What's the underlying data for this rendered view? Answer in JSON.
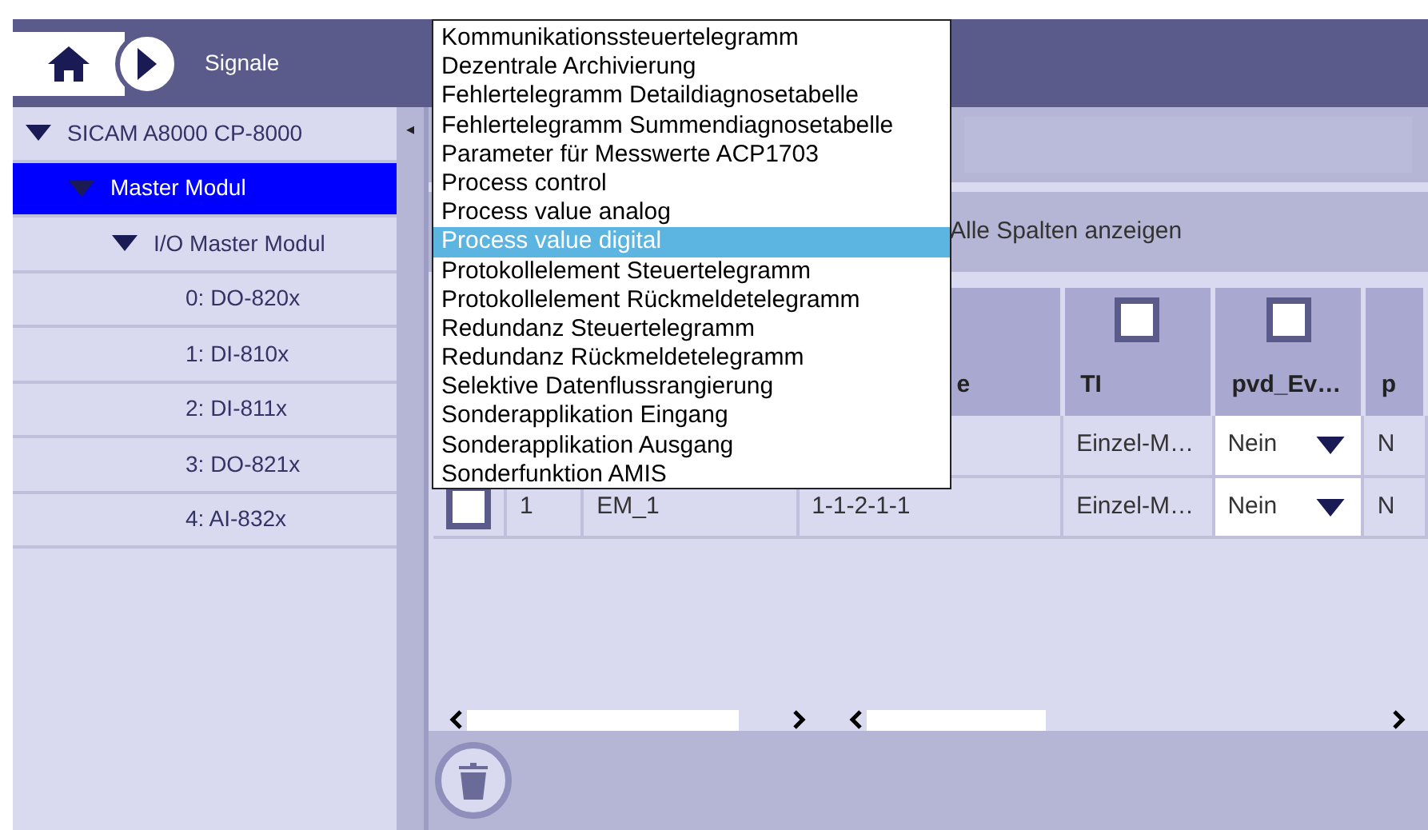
{
  "header": {
    "title": "Signale"
  },
  "sidebar": {
    "collapse": "◂",
    "items": [
      {
        "label": "SICAM A8000 CP-8000",
        "expanded": true,
        "selected": false,
        "children": [
          {
            "label": "Master Modul",
            "expanded": true,
            "selected": true,
            "children": [
              {
                "label": "I/O Master Modul",
                "expanded": true,
                "selected": false,
                "children": [
                  {
                    "label": "0: DO-820x",
                    "selected": false
                  },
                  {
                    "label": "1: DI-810x",
                    "selected": false
                  },
                  {
                    "label": "2: DI-811x",
                    "selected": false
                  },
                  {
                    "label": "3: DO-821x",
                    "selected": false
                  },
                  {
                    "label": "4: AI-832x",
                    "selected": false
                  }
                ]
              }
            ]
          }
        ]
      }
    ]
  },
  "toolbar": {
    "show_all_columns": "Alle Spalten anzeigen"
  },
  "table": {
    "columns": [
      {
        "kind": "text"
      },
      {
        "kind": "text"
      },
      {
        "kind": "text",
        "label": "e"
      },
      {
        "kind": "text",
        "label": "TI",
        "checked": false
      },
      {
        "kind": "combo",
        "label": "pvd_Ev…",
        "checked": false
      },
      {
        "kind": "text",
        "label": "p"
      }
    ],
    "rows": [
      {
        "cells": [
          null,
          null,
          null,
          "Einzel-M…",
          "Nein",
          "N"
        ]
      },
      {
        "checked": false,
        "cells": [
          "1",
          "EM_1",
          "1-1-2-1-1",
          "Einzel-M…",
          "Nein",
          "N"
        ]
      }
    ]
  },
  "dropdown": {
    "items": [
      {
        "label": "Kommunikationssteuertelegramm",
        "selected": false
      },
      {
        "label": "Dezentrale Archivierung",
        "selected": false
      },
      {
        "label": "Fehlertelegramm Detaildiagnosetabelle",
        "selected": false
      },
      {
        "label": "Fehlertelegramm Summendiagnosetabelle",
        "selected": false
      },
      {
        "label": "Parameter für Messwerte ACP1703",
        "selected": false
      },
      {
        "label": "Process control",
        "selected": false
      },
      {
        "label": "Process value analog",
        "selected": false
      },
      {
        "label": "Process value digital",
        "selected": true
      },
      {
        "label": "Protokollelement Steuertelegramm",
        "selected": false
      },
      {
        "label": "Protokollelement Rückmeldetelegramm",
        "selected": false
      },
      {
        "label": "Redundanz Steuertelegramm",
        "selected": false
      },
      {
        "label": "Redundanz Rückmeldetelegramm",
        "selected": false
      },
      {
        "label": "Selektive Datenflussrangierung",
        "selected": false
      },
      {
        "label": "Sonderapplikation Eingang",
        "selected": false
      },
      {
        "label": "Sonderapplikation Ausgang",
        "selected": false
      },
      {
        "label": "Sonderfunktion AMIS",
        "selected": false
      }
    ]
  }
}
